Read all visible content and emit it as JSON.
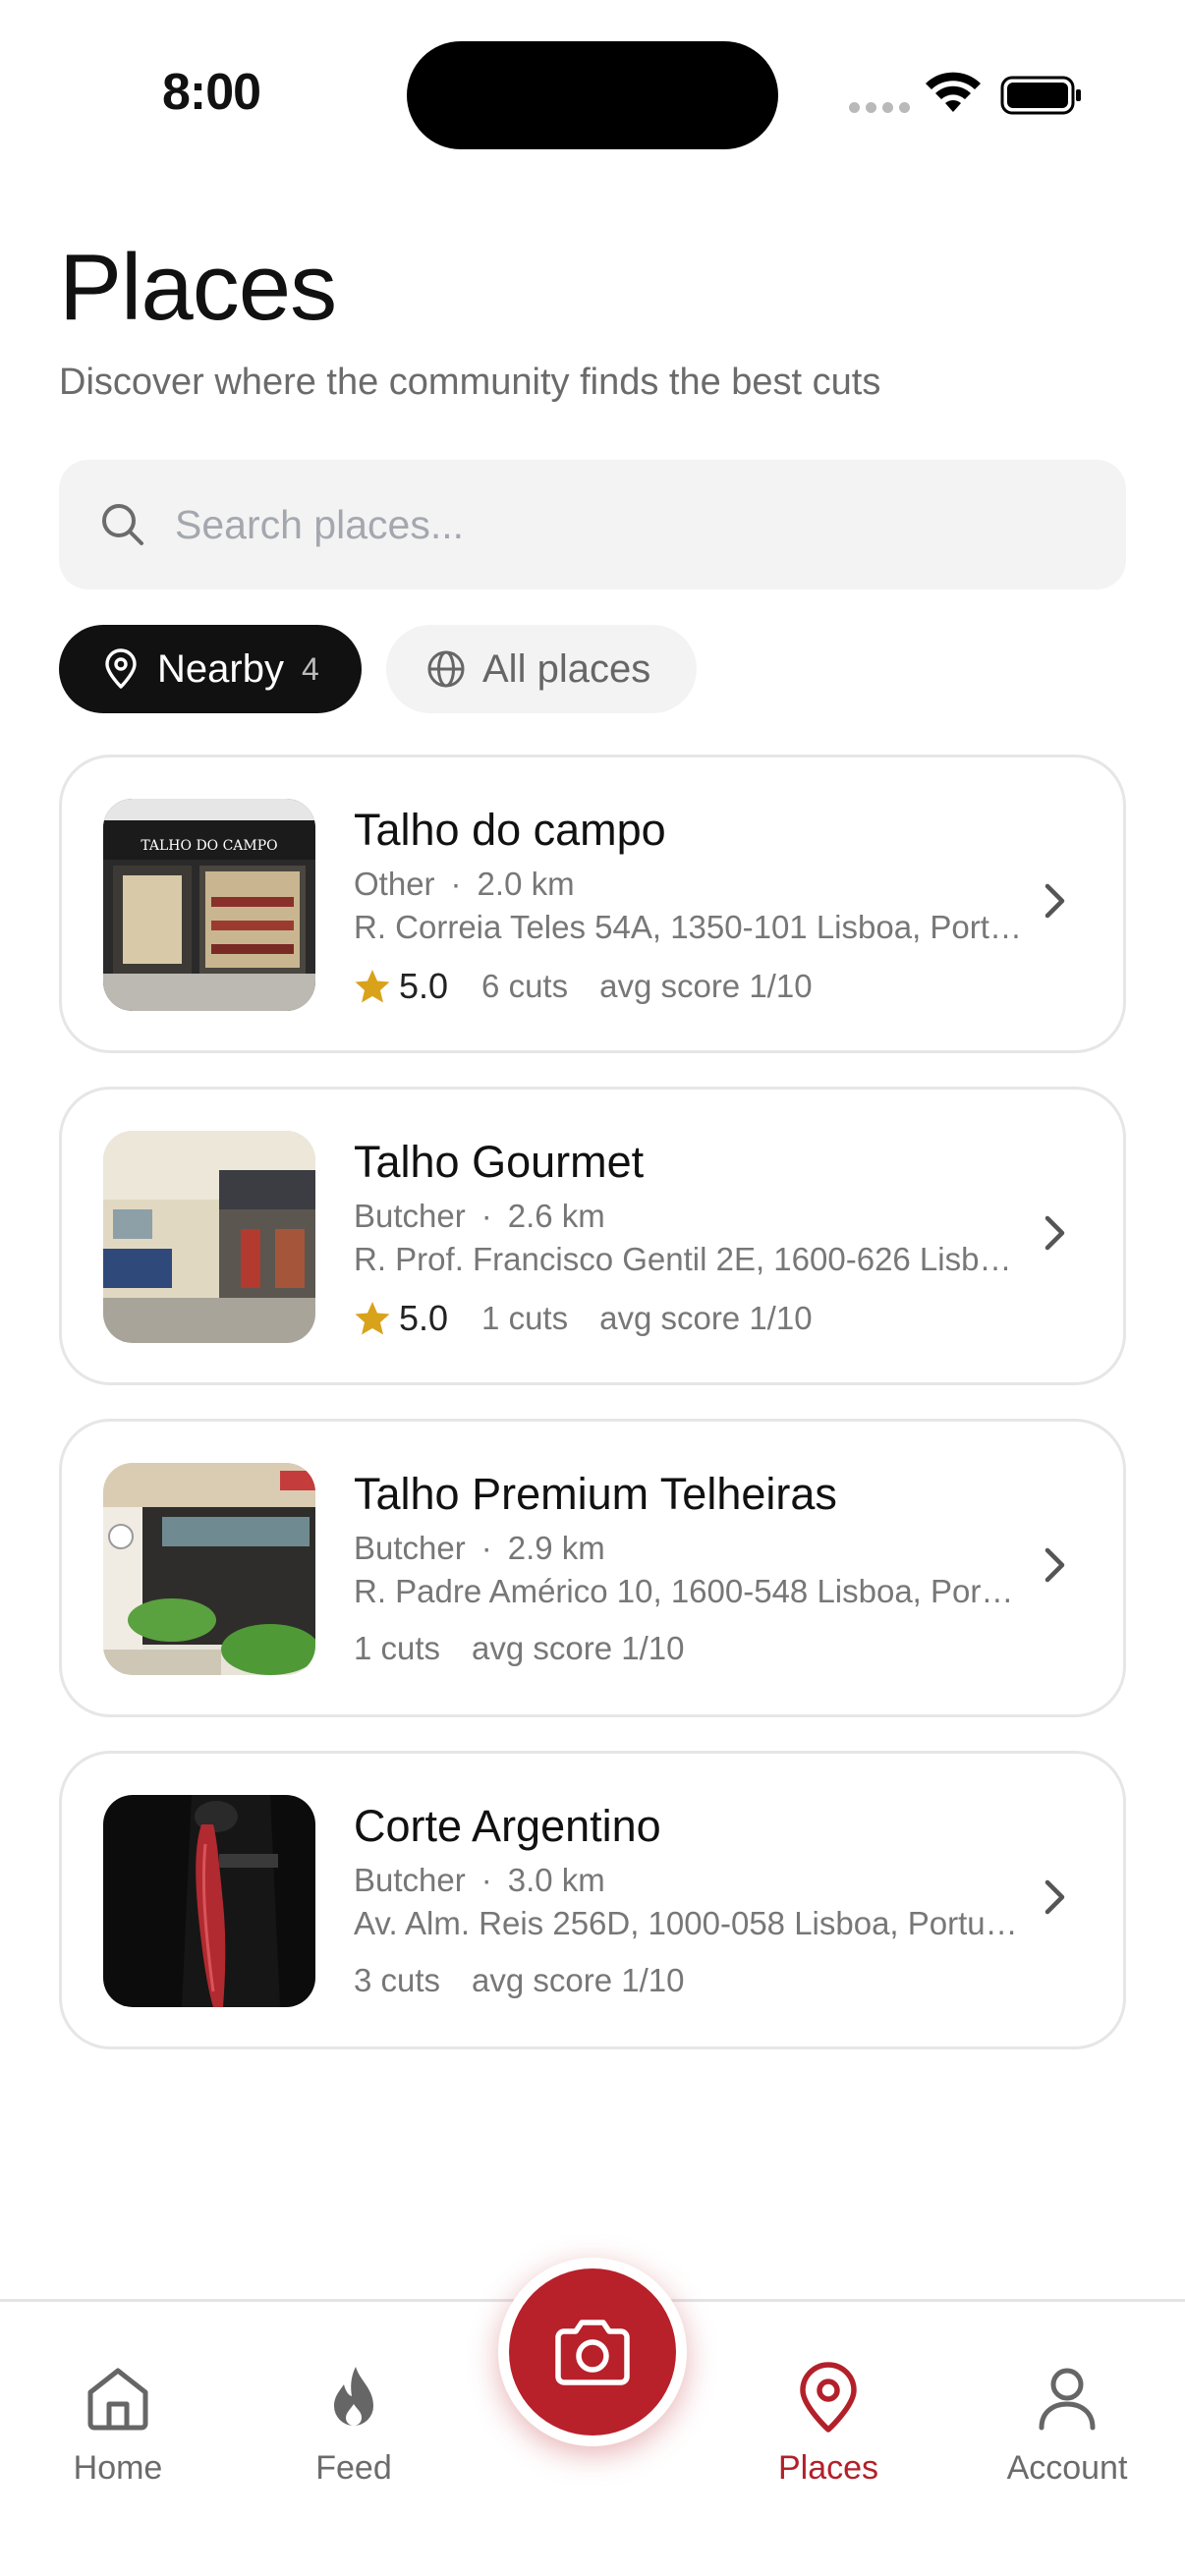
{
  "status_bar": {
    "time": "8:00"
  },
  "header": {
    "title": "Places",
    "subtitle": "Discover where the community finds the best cuts"
  },
  "search": {
    "placeholder": "Search places...",
    "value": ""
  },
  "filters": {
    "nearby": {
      "label": "Nearby",
      "count": "4",
      "selected": true
    },
    "all": {
      "label": "All places",
      "selected": false
    }
  },
  "places": [
    {
      "name": "Talho do campo",
      "category": "Other",
      "distance": "2.0 km",
      "address": "R. Correia Teles 54A, 1350-101 Lisboa, Portugal",
      "rating": "5.0",
      "cuts": "6 cuts",
      "avg_score": "avg score 1/10",
      "storefront_sign": "TALHO DO CAMPO"
    },
    {
      "name": "Talho Gourmet",
      "category": "Butcher",
      "distance": "2.6 km",
      "address": "R. Prof. Francisco Gentil 2E, 1600-626 Lisboa, Portugal",
      "rating": "5.0",
      "cuts": "1 cuts",
      "avg_score": "avg score 1/10"
    },
    {
      "name": "Talho Premium Telheiras",
      "category": "Butcher",
      "distance": "2.9 km",
      "address": "R. Padre Américo 10, 1600-548 Lisboa, Portugal",
      "cuts": "1 cuts",
      "avg_score": "avg score 1/10"
    },
    {
      "name": "Corte Argentino",
      "category": "Butcher",
      "distance": "3.0 km",
      "address": "Av. Alm. Reis 256D, 1000-058 Lisboa, Portugal",
      "cuts": "3 cuts",
      "avg_score": "avg score 1/10"
    }
  ],
  "tabbar": {
    "home": "Home",
    "feed": "Feed",
    "places": "Places",
    "account": "Account",
    "active": "places"
  },
  "colors": {
    "accent": "#b3202a",
    "star": "#d9a21b",
    "chip_active_bg": "#111111",
    "surface": "#f3f3f4"
  }
}
